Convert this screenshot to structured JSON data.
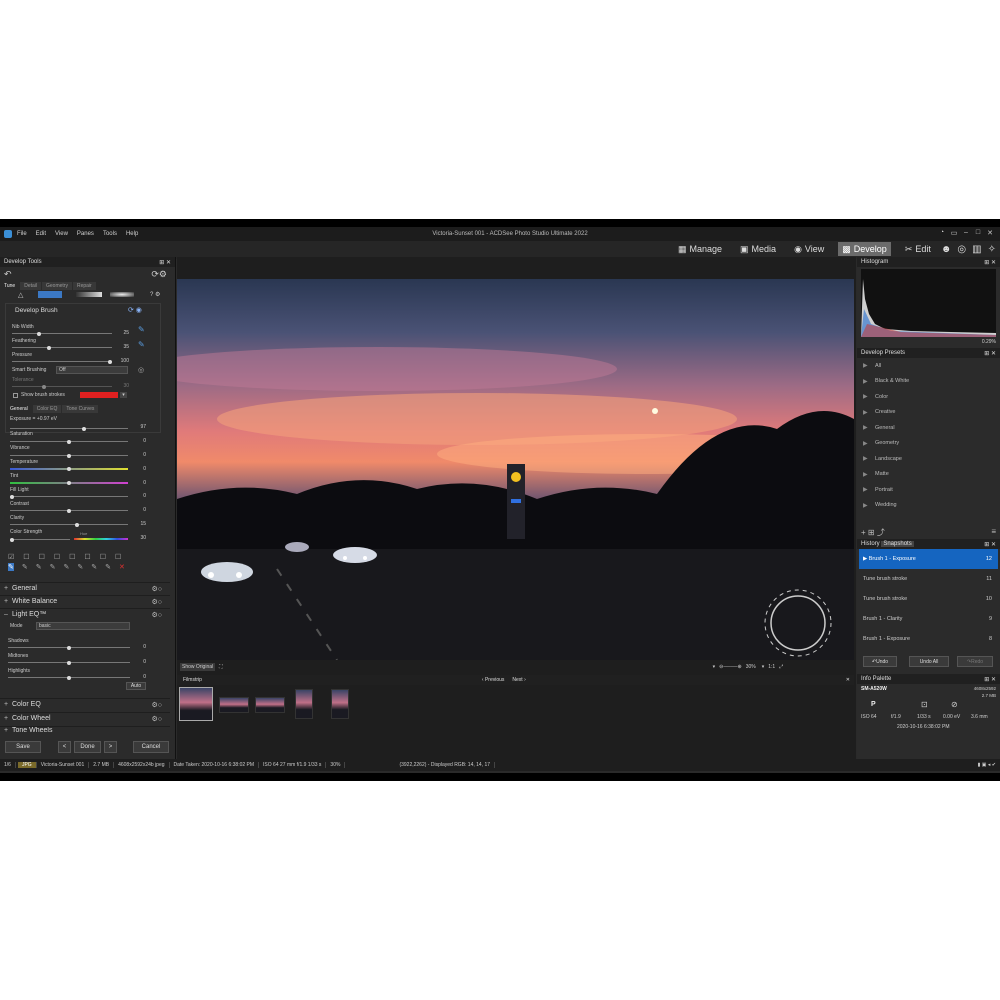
{
  "window": {
    "title": "Victoria-Sunset 001 - ACDSee Photo Studio Ultimate 2022"
  },
  "menu": [
    "File",
    "Edit",
    "View",
    "Panes",
    "Tools",
    "Help"
  ],
  "modes": [
    {
      "label": "Manage",
      "icon": "grid-icon"
    },
    {
      "label": "Media",
      "icon": "photo-icon"
    },
    {
      "label": "View",
      "icon": "eye-icon"
    },
    {
      "label": "Develop",
      "icon": "develop-icon",
      "active": true
    },
    {
      "label": "Edit",
      "icon": "edit-icon"
    }
  ],
  "left": {
    "panel_title": "Develop Tools",
    "tabs": [
      "Tune",
      "Detail",
      "Geometry",
      "Repair"
    ],
    "brush": {
      "title": "Develop Brush",
      "nib_width_label": "Nib Width",
      "nib_width": "25",
      "feathering_label": "Feathering",
      "feathering": "35",
      "pressure_label": "Pressure",
      "pressure": "100",
      "smart_brushing_label": "Smart Brushing",
      "smart_brushing": "Off",
      "tolerance_label": "Tolerance",
      "tolerance": "30",
      "show_strokes_label": "Show brush strokes",
      "stroke_color": "#e02020"
    },
    "subtabs": [
      "General",
      "Color EQ",
      "Tone Curves"
    ],
    "adjust": {
      "exposure_label": "Exposure = +0.97 eV",
      "exposure": "97",
      "saturation_label": "Saturation",
      "saturation": "0",
      "vibrance_label": "Vibrance",
      "vibrance": "0",
      "temperature_label": "Temperature",
      "temperature": "0",
      "tint_label": "Tint",
      "tint": "0",
      "fill_light_label": "Fill Light",
      "fill_light": "0",
      "contrast_label": "Contrast",
      "contrast": "0",
      "clarity_label": "Clarity",
      "clarity": "15",
      "color_strength_label": "Color Strength",
      "hue_label": "Hue",
      "color_strength": "30"
    },
    "sections": {
      "general": "General",
      "white_balance": "White Balance",
      "light_eq": "Light EQ™",
      "color_eq": "Color EQ",
      "color_wheel": "Color Wheel",
      "tone_wheels": "Tone Wheels"
    },
    "light_eq": {
      "mode_label": "Mode",
      "mode_value": "basic",
      "shadows_label": "Shadows",
      "shadows": "0",
      "midtones_label": "Midtones",
      "midtones": "0",
      "highlights_label": "Highlights",
      "highlights": "0",
      "auto_label": "Auto"
    },
    "footer": {
      "save": "Save",
      "done": "Done",
      "cancel": "Cancel",
      "prev": "<",
      "next": ">"
    }
  },
  "viewer": {
    "show_original": "Show Original",
    "zoom": "30%",
    "ratio": "1:1",
    "filmstrip_title": "Filmstrip",
    "previous": "Previous",
    "next": "Next"
  },
  "right": {
    "histogram_title": "Histogram",
    "histogram_pct": "0.29%",
    "presets_title": "Develop Presets",
    "presets": [
      "All",
      "Black & White",
      "Color",
      "Creative",
      "General",
      "Geometry",
      "Landscape",
      "Matte",
      "Portrait",
      "Wedding"
    ],
    "history_tabs": [
      "History",
      "Snapshots"
    ],
    "history": [
      {
        "label": "Brush 1 - Exposure",
        "num": "12",
        "selected": true
      },
      {
        "label": "Tune brush stroke",
        "num": "11"
      },
      {
        "label": "Tune brush stroke",
        "num": "10"
      },
      {
        "label": "Brush 1 - Clarity",
        "num": "9"
      },
      {
        "label": "Brush 1 - Exposure",
        "num": "8"
      }
    ],
    "undo": "Undo",
    "undo_all": "Undo All",
    "redo": "Redo",
    "info_title": "Info Palette",
    "camera": "SM-A520W",
    "dims": "4608x2592",
    "size": "2.7 MB",
    "mode": "P",
    "iso": "ISO 64",
    "aperture": "f/1.9",
    "shutter": "1/33 s",
    "ev": "0.00 eV",
    "focal": "3.6 mm",
    "date": "2020-10-16 6:38:02 PM"
  },
  "status": {
    "index": "1/6",
    "type": "JPG",
    "file": "Victoria-Sunset 001",
    "size": "2.7 MB",
    "dims": "4608x2592x24b jpeg",
    "date": "Date Taken: 2020-10-16 6:38:02 PM",
    "exif": "ISO 64   27 mm   f/1.9   1/33 s",
    "zoom": "30%",
    "pixel": "(3922,2262) - Displayed RGB: 14, 14, 17"
  }
}
